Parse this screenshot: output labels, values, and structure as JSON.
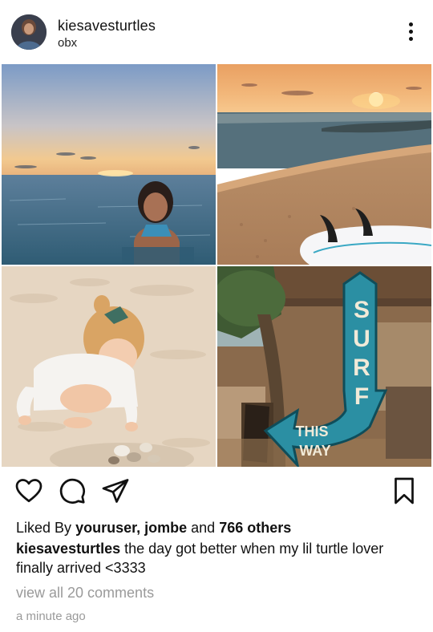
{
  "post": {
    "username": "kiesavesturtles",
    "location": "obx"
  },
  "images": [
    {
      "name": "ocean-sunset-swim-photo"
    },
    {
      "name": "beach-sunset-surfboard-photo"
    },
    {
      "name": "toddler-shells-sand-photo"
    },
    {
      "name": "surf-this-way-sign-photo",
      "sign_word": "SURF",
      "sign_sub1": "THIS",
      "sign_sub2": "WAY"
    }
  ],
  "likes": {
    "prefix": "Liked By",
    "users": "youruser, jombe",
    "middle": "and",
    "others": "766 others"
  },
  "caption": {
    "username": "kiesavesturtles",
    "text": "the day got better when my lil turtle lover finally arrived <3333"
  },
  "comments_link": "view all 20 comments",
  "timestamp": "a minute ago",
  "icons": [
    "heart-icon",
    "comment-icon",
    "share-icon",
    "bookmark-icon",
    "more-dots-icon"
  ]
}
